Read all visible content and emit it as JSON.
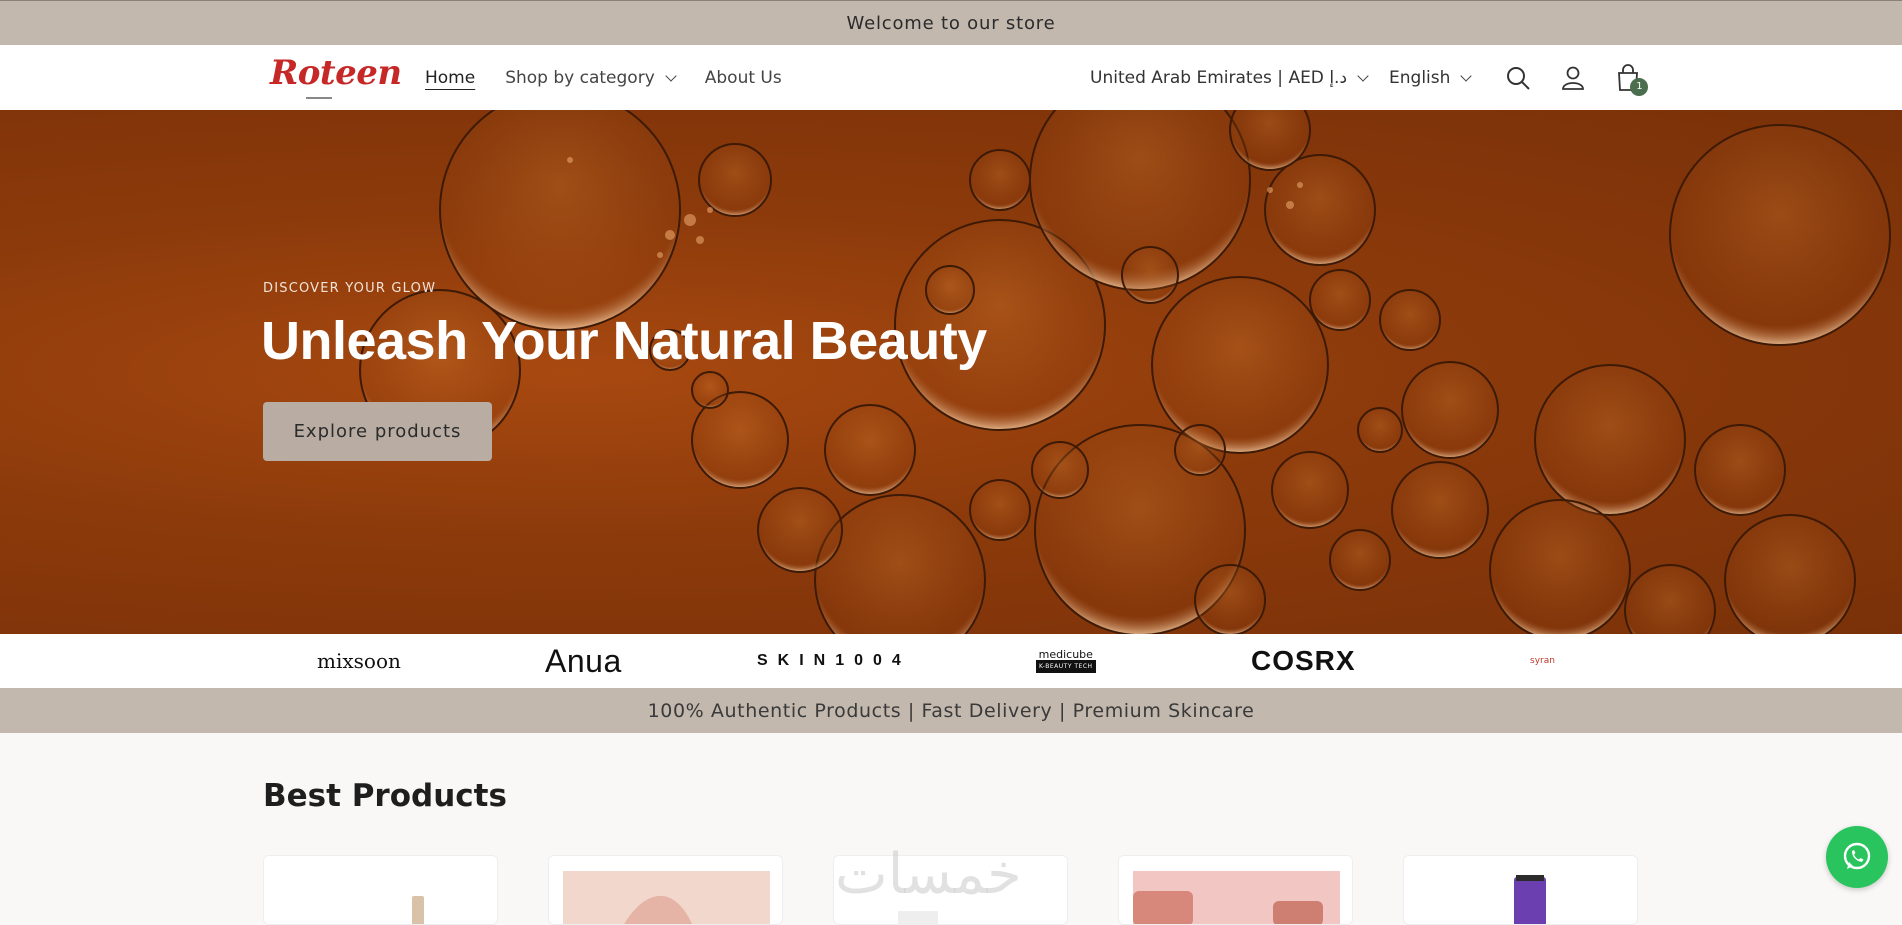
{
  "announcement": "Welcome to our store",
  "header": {
    "logo_text": "Roteen",
    "nav": [
      {
        "label": "Home"
      },
      {
        "label": "Shop by category"
      },
      {
        "label": "About Us"
      }
    ],
    "country_label": "United Arab Emirates | AED د.إ",
    "language_label": "English",
    "cart_count": "1"
  },
  "hero": {
    "eyebrow": "DISCOVER YOUR GLOW",
    "title": "Unleash Your Natural Beauty",
    "cta": "Explore products"
  },
  "brands": {
    "mixsoon": "mixsoon",
    "anua": "Anua",
    "skin1004": "SKIN1004",
    "medicube": "medicube",
    "medicube_tag": "K-BEAUTY TECH",
    "cosrx": "COSRX",
    "syran": "syran"
  },
  "trust_bar": "100% Authentic Products | Fast Delivery | Premium Skincare",
  "best_products": {
    "title": "Best Products",
    "product_thumbnails": [
      "#f3ebe3",
      "#f1d7cc",
      "#ffffff",
      "#f1c6c3",
      "#ffffff"
    ]
  },
  "colors": {
    "announcement_bg": "#c2b8ae",
    "hero_bg": "#8c3a0b",
    "logo": "#c62828",
    "cart_badge": "#4b6e4e",
    "whatsapp": "#2ac45f"
  },
  "watermark": "خمسات"
}
